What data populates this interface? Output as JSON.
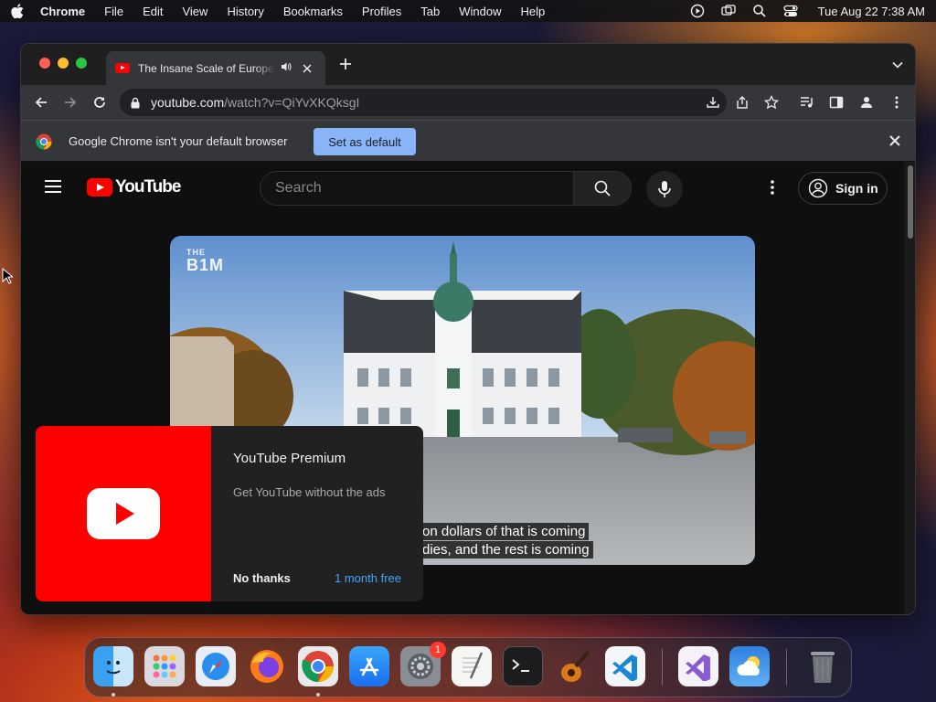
{
  "menubar": {
    "app_name": "Chrome",
    "items": [
      "File",
      "Edit",
      "View",
      "History",
      "Bookmarks",
      "Profiles",
      "Tab",
      "Window",
      "Help"
    ],
    "clock": "Tue Aug 22  7:38 AM",
    "status_icons": [
      "media-play-icon",
      "screen-mirroring-icon",
      "spotlight-search-icon",
      "control-center-icon"
    ]
  },
  "browser": {
    "tab_title": "The Insane Scale of Europe's",
    "omnibox": {
      "domain": "youtube.com",
      "path": "/watch?v=QiYvXKQksgI"
    },
    "infobar": {
      "message": "Google Chrome isn't your default browser",
      "button": "Set as default"
    }
  },
  "youtube": {
    "logo_text": "YouTube",
    "search_placeholder": "Search",
    "signin_label": "Sign in",
    "video": {
      "watermark_small": "THE",
      "watermark_big": "B1M",
      "caption_line1": "on dollars of that is coming",
      "caption_line2": "dies, and the rest is coming"
    },
    "promo": {
      "title": "YouTube Premium",
      "subtitle": "Get YouTube without the ads",
      "dismiss": "No thanks",
      "accept": "1 month free"
    }
  },
  "dock": {
    "apps": [
      "finder-icon",
      "launchpad-icon",
      "safari-icon",
      "firefox-icon",
      "chrome-icon",
      "app-store-icon",
      "system-settings-icon",
      "textedit-icon",
      "terminal-icon",
      "garageband-icon",
      "vscode-icon",
      "visual-studio-icon",
      "weather-icon",
      "trash-icon"
    ],
    "settings_badge": "1"
  },
  "colors": {
    "youtube_red": "#ff0000",
    "link_blue": "#3ea6ff",
    "infobar_button": "#8ab4f8"
  }
}
